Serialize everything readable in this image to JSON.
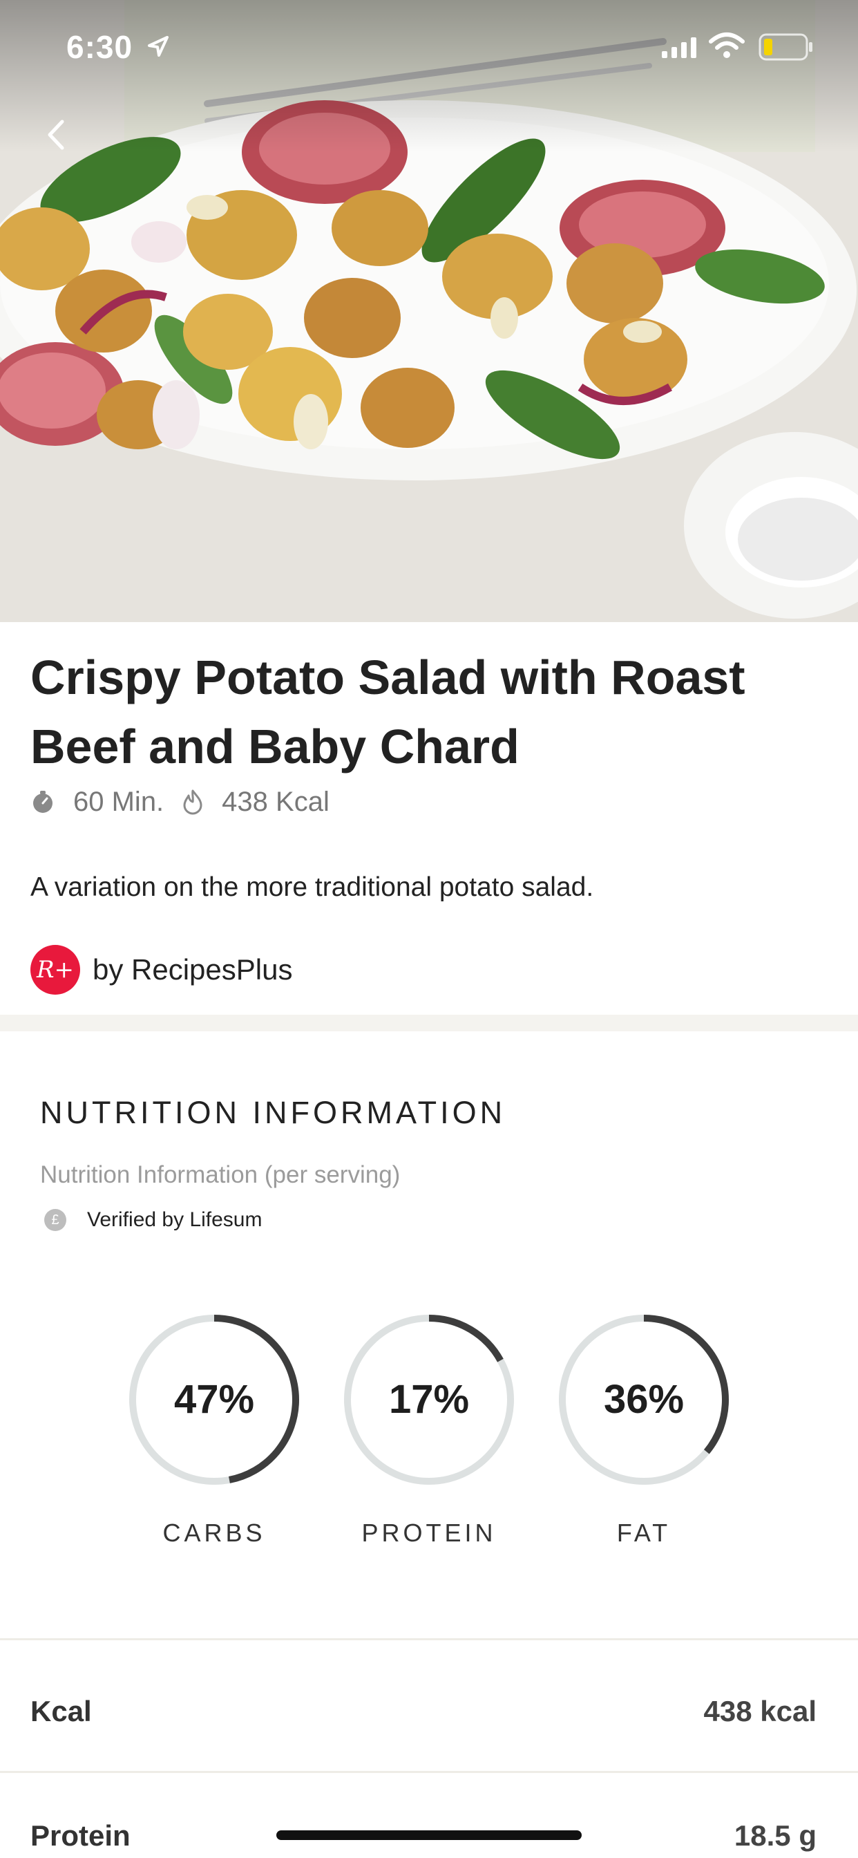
{
  "status_bar": {
    "time": "6:30"
  },
  "recipe": {
    "title": "Crispy Potato Salad with Roast Beef and Baby Chard",
    "time": "60 Min.",
    "kcal": "438 Kcal",
    "description": "A variation on the more traditional potato salad.",
    "author": "by RecipesPlus",
    "author_logo_text": "R+"
  },
  "nutrition": {
    "heading": "NUTRITION INFORMATION",
    "subheading": "Nutrition Information (per serving)",
    "verified": "Verified by Lifesum",
    "verified_icon_text": "£",
    "macros": [
      {
        "label": "CARBS",
        "percent_text": "47%",
        "percent": 47
      },
      {
        "label": "PROTEIN",
        "percent_text": "17%",
        "percent": 17
      },
      {
        "label": "FAT",
        "percent_text": "36%",
        "percent": 36
      }
    ],
    "rows": [
      {
        "label": "Kcal",
        "value": "438 kcal"
      },
      {
        "label": "Protein",
        "value": "18.5 g"
      }
    ]
  },
  "colors": {
    "ring_track": "#dde1e1",
    "ring_fill": "#3d3d3d",
    "author_brand": "#e8193c"
  }
}
